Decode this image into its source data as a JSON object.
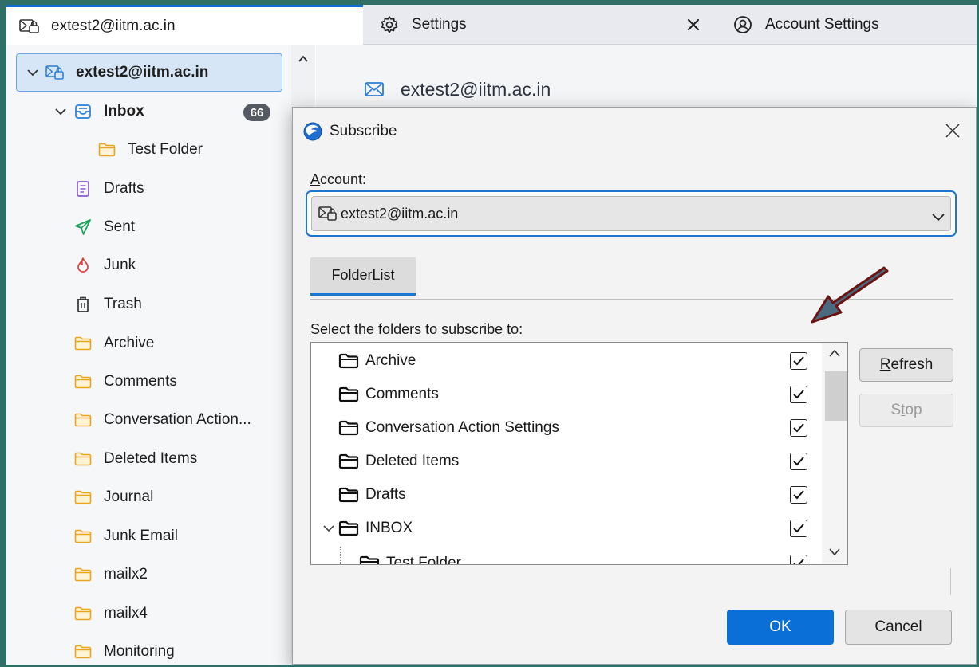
{
  "tabs": {
    "mail": "extest2@iitm.ac.in",
    "settings": "Settings",
    "account_settings": "Account Settings"
  },
  "folder_pane": {
    "account": "extest2@iitm.ac.in",
    "inbox": {
      "label": "Inbox",
      "unread": "66"
    },
    "items": [
      "Test Folder",
      "Drafts",
      "Sent",
      "Junk",
      "Trash",
      "Archive",
      "Comments",
      "Conversation Action...",
      "Deleted Items",
      "Journal",
      "Junk Email",
      "mailx2",
      "mailx4",
      "Monitoring"
    ]
  },
  "right_pane": {
    "header": "extest2@iitm.ac.in"
  },
  "dialog": {
    "title": "Subscribe",
    "account_label": {
      "a": "A",
      "rest": "ccount:"
    },
    "account_value": "extest2@iitm.ac.in",
    "tab": {
      "pre": "Folder ",
      "u": "L",
      "post": "ist"
    },
    "select_label": "Select the folders to subscribe to:",
    "folders": [
      {
        "name": "Archive",
        "checked": true
      },
      {
        "name": "Comments",
        "checked": true
      },
      {
        "name": "Conversation Action Settings",
        "checked": true
      },
      {
        "name": "Deleted Items",
        "checked": true
      },
      {
        "name": "Drafts",
        "checked": true
      },
      {
        "name": "INBOX",
        "checked": true
      },
      {
        "name": "Test Folder",
        "checked": true
      }
    ],
    "buttons": {
      "refresh": {
        "u": "R",
        "rest": "efresh"
      },
      "stop": {
        "pre": "S",
        "u": "t",
        "post": "op"
      },
      "ok": "OK",
      "cancel": "Cancel"
    }
  },
  "colors": {
    "accent": "#0a6fd6",
    "annotation_arrow": "#4a6a80",
    "arrow_border": "#6b1414"
  }
}
